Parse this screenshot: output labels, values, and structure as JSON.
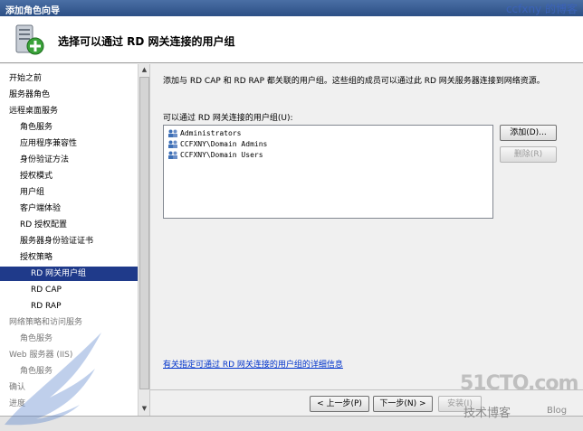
{
  "window": {
    "title": "添加角色向导"
  },
  "watermark_top": "ccfxny 的博客",
  "header": {
    "title": "选择可以通过 RD 网关连接的用户组"
  },
  "sidebar": {
    "items": [
      {
        "label": "开始之前",
        "level": 0,
        "state": "normal"
      },
      {
        "label": "服务器角色",
        "level": 0,
        "state": "normal"
      },
      {
        "label": "远程桌面服务",
        "level": 0,
        "state": "normal"
      },
      {
        "label": "角色服务",
        "level": 1,
        "state": "normal"
      },
      {
        "label": "应用程序兼容性",
        "level": 1,
        "state": "normal"
      },
      {
        "label": "身份验证方法",
        "level": 1,
        "state": "normal"
      },
      {
        "label": "授权模式",
        "level": 1,
        "state": "normal"
      },
      {
        "label": "用户组",
        "level": 1,
        "state": "normal"
      },
      {
        "label": "客户端体验",
        "level": 1,
        "state": "normal"
      },
      {
        "label": "RD 授权配置",
        "level": 1,
        "state": "normal"
      },
      {
        "label": "服务器身份验证证书",
        "level": 1,
        "state": "normal"
      },
      {
        "label": "授权策略",
        "level": 1,
        "state": "normal"
      },
      {
        "label": "RD 网关用户组",
        "level": 2,
        "state": "selected"
      },
      {
        "label": "RD CAP",
        "level": 2,
        "state": "normal"
      },
      {
        "label": "RD RAP",
        "level": 2,
        "state": "normal"
      },
      {
        "label": "网络策略和访问服务",
        "level": 0,
        "state": "faded"
      },
      {
        "label": "角色服务",
        "level": 1,
        "state": "faded"
      },
      {
        "label": "Web 服务器 (IIS)",
        "level": 0,
        "state": "faded"
      },
      {
        "label": "角色服务",
        "level": 1,
        "state": "faded"
      },
      {
        "label": "确认",
        "level": 0,
        "state": "faded"
      },
      {
        "label": "进度",
        "level": 0,
        "state": "faded"
      }
    ]
  },
  "content": {
    "description": "添加与 RD CAP 和 RD RAP 都关联的用户组。这些组的成员可以通过此 RD 网关服务器连接到网络资源。",
    "list_label": "可以通过 RD 网关连接的用户组(U):",
    "groups": [
      "Administrators",
      "CCFXNY\\Domain Admins",
      "CCFXNY\\Domain Users"
    ],
    "add_button": "添加(D)...",
    "remove_button": "删除(R)",
    "help_link": "有关指定可通过 RD 网关连接的用户组的详细信息"
  },
  "footer": {
    "back_button": "< 上一步(P)",
    "next_button": "下一步(N) >",
    "install_button": "安装(I)"
  },
  "watermarks": {
    "site": "51CTO.com",
    "blog": "技术博客",
    "blog_en": "Blog"
  }
}
